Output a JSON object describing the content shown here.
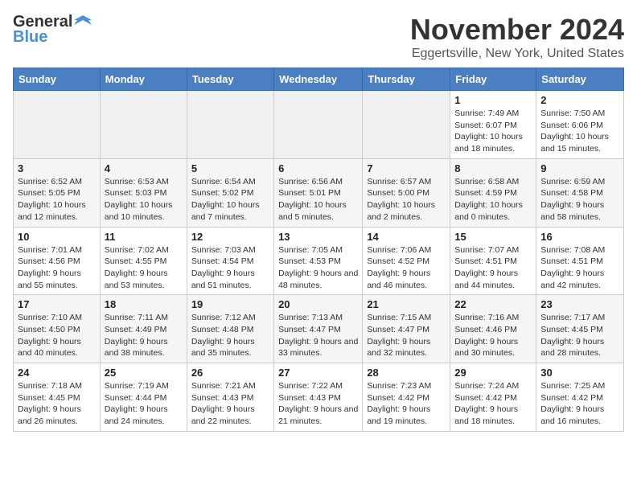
{
  "header": {
    "logo_general": "General",
    "logo_blue": "Blue",
    "month": "November 2024",
    "location": "Eggertsville, New York, United States"
  },
  "weekdays": [
    "Sunday",
    "Monday",
    "Tuesday",
    "Wednesday",
    "Thursday",
    "Friday",
    "Saturday"
  ],
  "weeks": [
    [
      {
        "day": "",
        "info": ""
      },
      {
        "day": "",
        "info": ""
      },
      {
        "day": "",
        "info": ""
      },
      {
        "day": "",
        "info": ""
      },
      {
        "day": "",
        "info": ""
      },
      {
        "day": "1",
        "info": "Sunrise: 7:49 AM\nSunset: 6:07 PM\nDaylight: 10 hours and 18 minutes."
      },
      {
        "day": "2",
        "info": "Sunrise: 7:50 AM\nSunset: 6:06 PM\nDaylight: 10 hours and 15 minutes."
      }
    ],
    [
      {
        "day": "3",
        "info": "Sunrise: 6:52 AM\nSunset: 5:05 PM\nDaylight: 10 hours and 12 minutes."
      },
      {
        "day": "4",
        "info": "Sunrise: 6:53 AM\nSunset: 5:03 PM\nDaylight: 10 hours and 10 minutes."
      },
      {
        "day": "5",
        "info": "Sunrise: 6:54 AM\nSunset: 5:02 PM\nDaylight: 10 hours and 7 minutes."
      },
      {
        "day": "6",
        "info": "Sunrise: 6:56 AM\nSunset: 5:01 PM\nDaylight: 10 hours and 5 minutes."
      },
      {
        "day": "7",
        "info": "Sunrise: 6:57 AM\nSunset: 5:00 PM\nDaylight: 10 hours and 2 minutes."
      },
      {
        "day": "8",
        "info": "Sunrise: 6:58 AM\nSunset: 4:59 PM\nDaylight: 10 hours and 0 minutes."
      },
      {
        "day": "9",
        "info": "Sunrise: 6:59 AM\nSunset: 4:58 PM\nDaylight: 9 hours and 58 minutes."
      }
    ],
    [
      {
        "day": "10",
        "info": "Sunrise: 7:01 AM\nSunset: 4:56 PM\nDaylight: 9 hours and 55 minutes."
      },
      {
        "day": "11",
        "info": "Sunrise: 7:02 AM\nSunset: 4:55 PM\nDaylight: 9 hours and 53 minutes."
      },
      {
        "day": "12",
        "info": "Sunrise: 7:03 AM\nSunset: 4:54 PM\nDaylight: 9 hours and 51 minutes."
      },
      {
        "day": "13",
        "info": "Sunrise: 7:05 AM\nSunset: 4:53 PM\nDaylight: 9 hours and 48 minutes."
      },
      {
        "day": "14",
        "info": "Sunrise: 7:06 AM\nSunset: 4:52 PM\nDaylight: 9 hours and 46 minutes."
      },
      {
        "day": "15",
        "info": "Sunrise: 7:07 AM\nSunset: 4:51 PM\nDaylight: 9 hours and 44 minutes."
      },
      {
        "day": "16",
        "info": "Sunrise: 7:08 AM\nSunset: 4:51 PM\nDaylight: 9 hours and 42 minutes."
      }
    ],
    [
      {
        "day": "17",
        "info": "Sunrise: 7:10 AM\nSunset: 4:50 PM\nDaylight: 9 hours and 40 minutes."
      },
      {
        "day": "18",
        "info": "Sunrise: 7:11 AM\nSunset: 4:49 PM\nDaylight: 9 hours and 38 minutes."
      },
      {
        "day": "19",
        "info": "Sunrise: 7:12 AM\nSunset: 4:48 PM\nDaylight: 9 hours and 35 minutes."
      },
      {
        "day": "20",
        "info": "Sunrise: 7:13 AM\nSunset: 4:47 PM\nDaylight: 9 hours and 33 minutes."
      },
      {
        "day": "21",
        "info": "Sunrise: 7:15 AM\nSunset: 4:47 PM\nDaylight: 9 hours and 32 minutes."
      },
      {
        "day": "22",
        "info": "Sunrise: 7:16 AM\nSunset: 4:46 PM\nDaylight: 9 hours and 30 minutes."
      },
      {
        "day": "23",
        "info": "Sunrise: 7:17 AM\nSunset: 4:45 PM\nDaylight: 9 hours and 28 minutes."
      }
    ],
    [
      {
        "day": "24",
        "info": "Sunrise: 7:18 AM\nSunset: 4:45 PM\nDaylight: 9 hours and 26 minutes."
      },
      {
        "day": "25",
        "info": "Sunrise: 7:19 AM\nSunset: 4:44 PM\nDaylight: 9 hours and 24 minutes."
      },
      {
        "day": "26",
        "info": "Sunrise: 7:21 AM\nSunset: 4:43 PM\nDaylight: 9 hours and 22 minutes."
      },
      {
        "day": "27",
        "info": "Sunrise: 7:22 AM\nSunset: 4:43 PM\nDaylight: 9 hours and 21 minutes."
      },
      {
        "day": "28",
        "info": "Sunrise: 7:23 AM\nSunset: 4:42 PM\nDaylight: 9 hours and 19 minutes."
      },
      {
        "day": "29",
        "info": "Sunrise: 7:24 AM\nSunset: 4:42 PM\nDaylight: 9 hours and 18 minutes."
      },
      {
        "day": "30",
        "info": "Sunrise: 7:25 AM\nSunset: 4:42 PM\nDaylight: 9 hours and 16 minutes."
      }
    ]
  ]
}
